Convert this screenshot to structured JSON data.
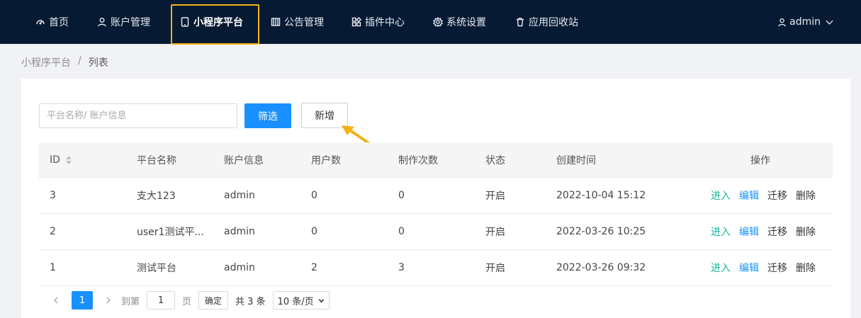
{
  "nav": {
    "items": [
      {
        "label": "首页",
        "icon": "dashboard-icon"
      },
      {
        "label": "账户管理",
        "icon": "user-icon"
      },
      {
        "label": "小程序平台",
        "icon": "tablet-icon"
      },
      {
        "label": "公告管理",
        "icon": "grid-icon"
      },
      {
        "label": "插件中心",
        "icon": "plugin-icon"
      },
      {
        "label": "系统设置",
        "icon": "gear-icon"
      },
      {
        "label": "应用回收站",
        "icon": "trash-icon"
      }
    ],
    "active_index": 2,
    "user": "admin",
    "highlight_color": "#f5b016"
  },
  "breadcrumb": {
    "parent": "小程序平台",
    "separator": "/",
    "current": "列表"
  },
  "toolbar": {
    "search_placeholder": "平台名称/ 账户信息",
    "filter_label": "筛选",
    "add_label": "新增"
  },
  "table": {
    "headers": [
      "ID",
      "平台名称",
      "账户信息",
      "用户数",
      "制作次数",
      "状态",
      "创建时间",
      "操作"
    ],
    "rows": [
      {
        "id": "3",
        "name": "支大123",
        "account": "admin",
        "users": "0",
        "builds": "0",
        "status": "开启",
        "created": "2022-10-04 15:12"
      },
      {
        "id": "2",
        "name": "user1测试平...",
        "account": "admin",
        "users": "0",
        "builds": "0",
        "status": "开启",
        "created": "2022-03-26 10:25"
      },
      {
        "id": "1",
        "name": "测试平台",
        "account": "admin",
        "users": "2",
        "builds": "3",
        "status": "开启",
        "created": "2022-03-26 09:32"
      }
    ],
    "actions": {
      "enter": "进入",
      "edit": "编辑",
      "move": "迁移",
      "delete": "删除"
    }
  },
  "pagination": {
    "current_page": "1",
    "goto_prefix": "到第",
    "goto_value": "1",
    "goto_suffix": "页",
    "confirm_label": "确定",
    "total_text": "共 3 条",
    "page_size": "10 条/页"
  },
  "colors": {
    "nav_bg": "#071a33",
    "primary": "#1890ff",
    "enter_action": "#18b89a",
    "arrow": "#f5b016"
  }
}
